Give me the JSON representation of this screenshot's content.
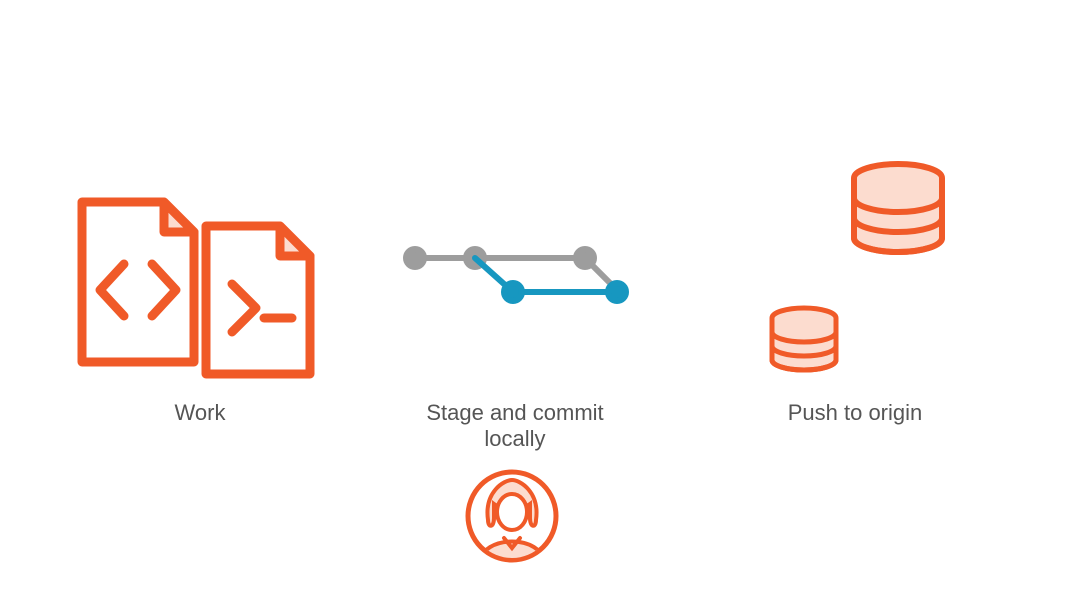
{
  "steps": {
    "work": {
      "label": "Work"
    },
    "commit": {
      "label": "Stage and commit locally"
    },
    "push": {
      "label": "Push to origin"
    }
  },
  "colors": {
    "orange": "#F05A28",
    "orange_fill": "#FCDCCF",
    "gray": "#9D9D9D",
    "blue": "#1797C0"
  }
}
